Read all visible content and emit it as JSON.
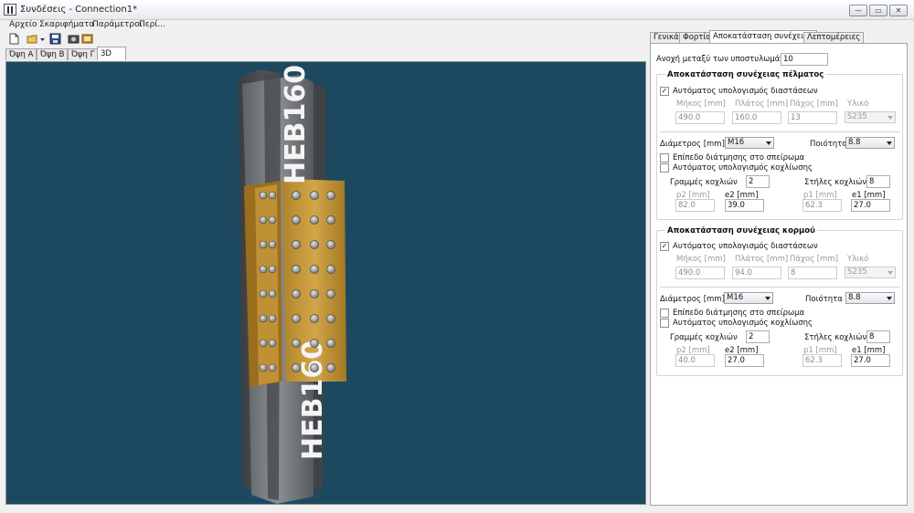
{
  "window": {
    "title": "Συνδέσεις - Connection1*"
  },
  "menu": [
    "Αρχείο",
    "Σκαριφήματα",
    "Παράμετροι",
    "Περί..."
  ],
  "view_tabs": [
    "Όψη Α",
    "Όψη Β",
    "Όψη Γ",
    "3D"
  ],
  "viewport": {
    "profile_label": "HEB160",
    "background": "#1c4960"
  },
  "panel_tabs": [
    "Γενικά",
    "Φορτία",
    "Αποκατάσταση συνέχειας",
    "Λεπτομέρειες"
  ],
  "gap": {
    "label": "Ανοχή μεταξύ των υποστυλωμάτων",
    "value": "10"
  },
  "labels": {
    "auto_dims": "Αυτόματος υπολογισμός διαστάσεων",
    "length": "Μήκος [mm]",
    "width": "Πλάτος [mm]",
    "thickness": "Πάχος [mm]",
    "material": "Υλικό",
    "diameter": "Διάμετρος [mm]",
    "quality": "Ποιότητα",
    "shear_plane": "Επίπεδο διάτμησης στο σπείρωμα",
    "auto_bolts": "Αυτόματος υπολογισμός κοχλίωσης",
    "rows": "Γραμμές κοχλιών",
    "cols": "Στήλες κοχλιών",
    "p2": "p2 [mm]",
    "e2": "e2 [mm]",
    "p1": "p1 [mm]",
    "e1": "e1 [mm]"
  },
  "flange": {
    "title": "Αποκατάσταση συνέχειας πέλματος",
    "auto_dims": true,
    "length": "490.0",
    "width": "160.0",
    "thickness": "13",
    "material": "S235",
    "diameter": "M16",
    "quality": "8.8",
    "shear_plane": false,
    "auto_bolts": false,
    "rows": "2",
    "cols": "8",
    "p2": "82.0",
    "e2": "39.0",
    "p1": "62.3",
    "e1": "27.0"
  },
  "web": {
    "title": "Αποκατάσταση συνέχειας κορμού",
    "auto_dims": true,
    "length": "490.0",
    "width": "94.0",
    "thickness": "8",
    "material": "S235",
    "diameter": "M16",
    "quality": "8.8",
    "shear_plane": false,
    "auto_bolts": false,
    "rows": "2",
    "cols": "8",
    "p2": "40.0",
    "e2": "27.0",
    "p1": "62.3",
    "e1": "27.0"
  }
}
